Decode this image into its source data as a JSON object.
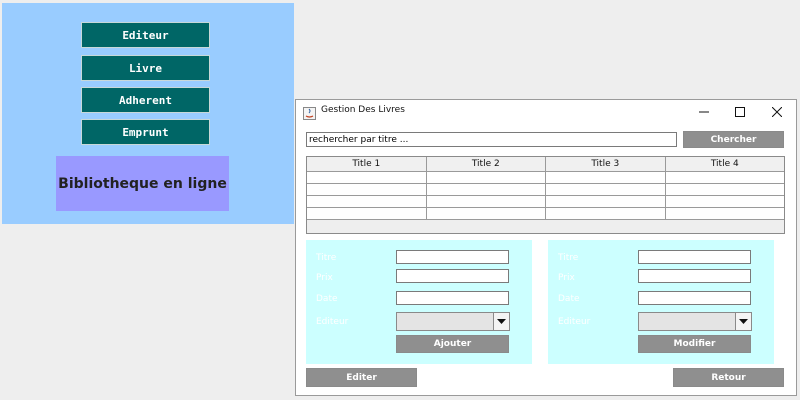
{
  "menu": {
    "items": [
      {
        "label": "Editeur"
      },
      {
        "label": "Livre"
      },
      {
        "label": "Adherent"
      },
      {
        "label": "Emprunt"
      }
    ],
    "home_title": "Bibliotheque en ligne"
  },
  "window": {
    "title": "Gestion Des Livres",
    "controls": {
      "minimize": "—",
      "maximize": "☐",
      "close": "✕"
    }
  },
  "search": {
    "value": "rechercher par titre ...",
    "button_label": "Chercher"
  },
  "table": {
    "headers": [
      "Title 1",
      "Title 2",
      "Title 3",
      "Title 4"
    ],
    "rows": [
      [
        "",
        "",
        "",
        ""
      ],
      [
        "",
        "",
        "",
        ""
      ],
      [
        "",
        "",
        "",
        ""
      ],
      [
        "",
        "",
        "",
        ""
      ]
    ]
  },
  "add_form": {
    "fields": [
      {
        "label": "Titre",
        "value": ""
      },
      {
        "label": "Prix",
        "value": ""
      },
      {
        "label": "Date",
        "value": ""
      }
    ],
    "combo_label": "Editeur",
    "combo_value": "",
    "submit_label": "Ajouter"
  },
  "edit_form": {
    "fields": [
      {
        "label": "Titre",
        "value": ""
      },
      {
        "label": "Prix",
        "value": ""
      },
      {
        "label": "Date",
        "value": ""
      }
    ],
    "combo_label": "Editeur",
    "combo_value": "",
    "submit_label": "Modifier"
  },
  "footer": {
    "edit_label": "Editer",
    "back_label": "Retour"
  },
  "colors": {
    "menu_bg": "#99ccff",
    "menu_button": "#006666",
    "home_title_bg": "#9999ff",
    "form_bg": "#ccffff",
    "button_grey": "#8f8f8f"
  }
}
